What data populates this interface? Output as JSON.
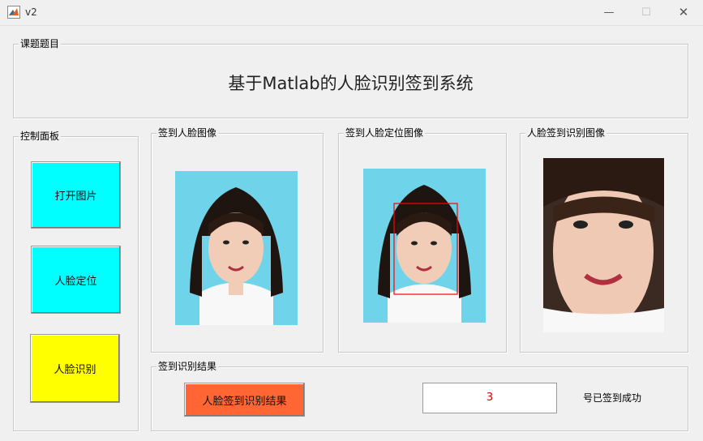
{
  "window": {
    "title": "v2"
  },
  "topic_panel": {
    "label": "课题题目",
    "title": "基于Matlab的人脸识别签到系统"
  },
  "control_panel": {
    "label": "控制面板",
    "buttons": [
      {
        "label": "打开图片",
        "color": "#00ffff"
      },
      {
        "label": "人脸定位",
        "color": "#00ffff"
      },
      {
        "label": "人脸识别",
        "color": "#ffff00"
      }
    ]
  },
  "image_panels": [
    {
      "label": "签到人脸图像"
    },
    {
      "label": "签到人脸定位图像"
    },
    {
      "label": "人脸签到识别图像"
    }
  ],
  "result_panel": {
    "label": "签到识别结果",
    "button_label": "人脸签到识别结果",
    "button_color": "#ff6633",
    "value": "3",
    "status_text": "号已签到成功"
  }
}
